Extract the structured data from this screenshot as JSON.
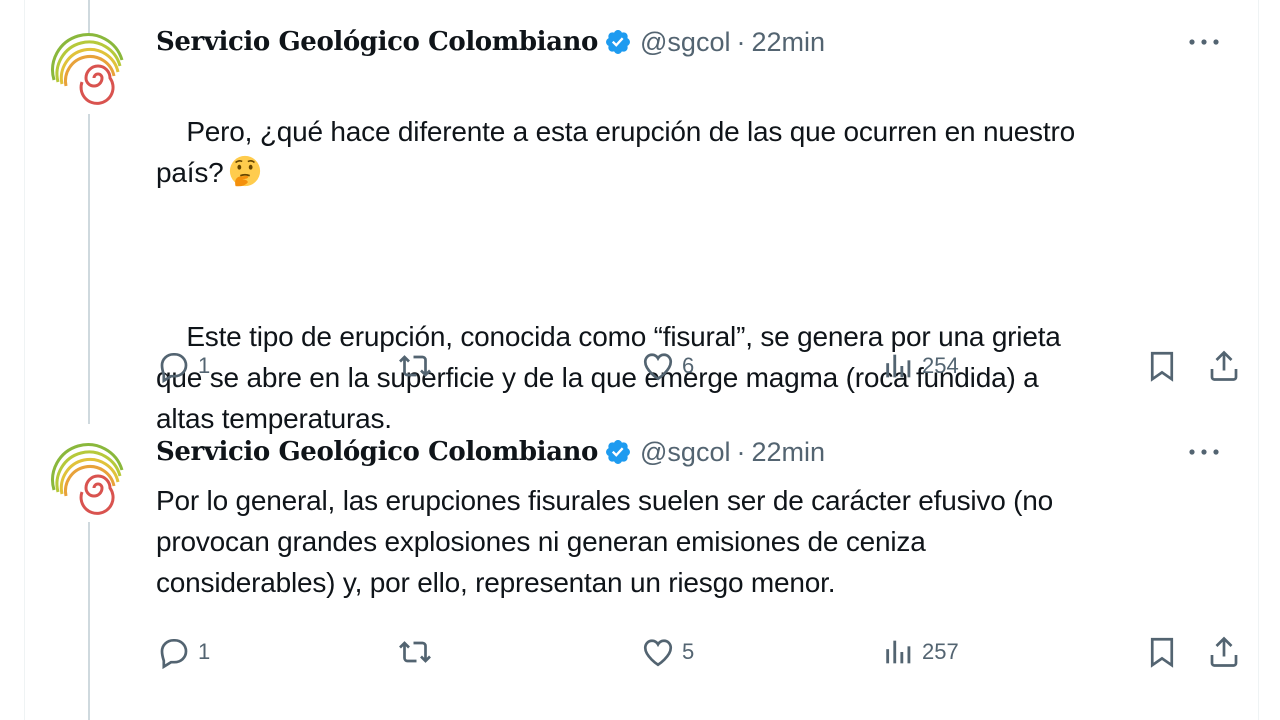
{
  "tweets": [
    {
      "author": {
        "display_name": "Servicio Geológico Colombiano",
        "verified": true,
        "handle": "@sgcol",
        "separator": "·",
        "time": "22min",
        "avatar_icon": "sgc-logo-icon"
      },
      "text_lines": "Pero, ¿qué hace diferente a esta erupción de las que ocurren en nuestro\npaís?",
      "emoji": "thinking-face-icon",
      "text_paragraph_2": "Este tipo de erupción, conocida como “fisural”, se genera por una grieta\nque se abre en la superficie y de la que emerge magma (roca fundida) a\naltas temperaturas.",
      "actions": {
        "replies": "1",
        "retweets": "",
        "likes": "6",
        "views": "254"
      }
    },
    {
      "author": {
        "display_name": "Servicio Geológico Colombiano",
        "verified": true,
        "handle": "@sgcol",
        "separator": "·",
        "time": "22min",
        "avatar_icon": "sgc-logo-icon"
      },
      "text": "Por lo general, las erupciones fisurales suelen ser de carácter efusivo (no\nprovocan grandes explosiones ni generan emisiones de ceniza\nconsiderables) y, por ello, representan un riesgo menor.",
      "actions": {
        "replies": "1",
        "retweets": "",
        "likes": "5",
        "views": "257"
      }
    }
  ],
  "colors": {
    "text_primary": "#0f1419",
    "text_secondary": "#536471",
    "verified_blue": "#1d9bf0",
    "thread_line": "#cfd9de"
  }
}
